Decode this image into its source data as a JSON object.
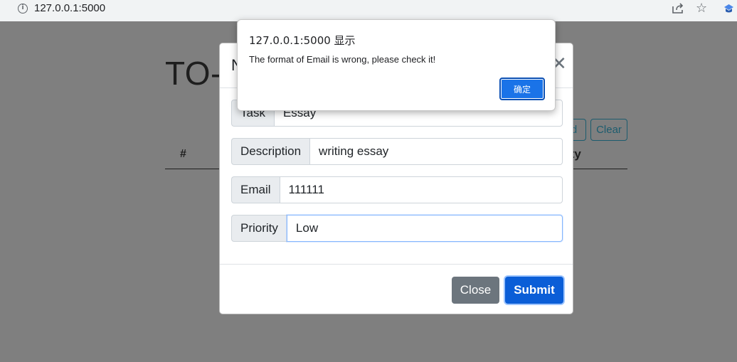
{
  "browser": {
    "url": "127.0.0.1:5000",
    "info_icon": "i"
  },
  "page": {
    "title": "TO-",
    "buttons": {
      "add_fragment": "d",
      "clear": "Clear"
    },
    "table_headers": {
      "hash": "#",
      "priority_fragment": "ority"
    }
  },
  "modal": {
    "title_fragment": "N",
    "close_glyph": "✕",
    "fields": [
      {
        "label": "Task",
        "value": "Essay"
      },
      {
        "label": "Description",
        "value": "writing essay"
      },
      {
        "label": "Email",
        "value": "111111"
      },
      {
        "label": "Priority",
        "value": "Low"
      }
    ],
    "buttons": {
      "close": "Close",
      "submit": "Submit"
    }
  },
  "alert": {
    "title": "127.0.0.1:5000 显示",
    "message": "The format of Email is wrong, please check it!",
    "ok": "确定"
  },
  "colors": {
    "overlay": "#7f7f7f",
    "primary": "#0b5ed7",
    "secondary": "#6c757d",
    "alert_button": "#1a73e8"
  }
}
